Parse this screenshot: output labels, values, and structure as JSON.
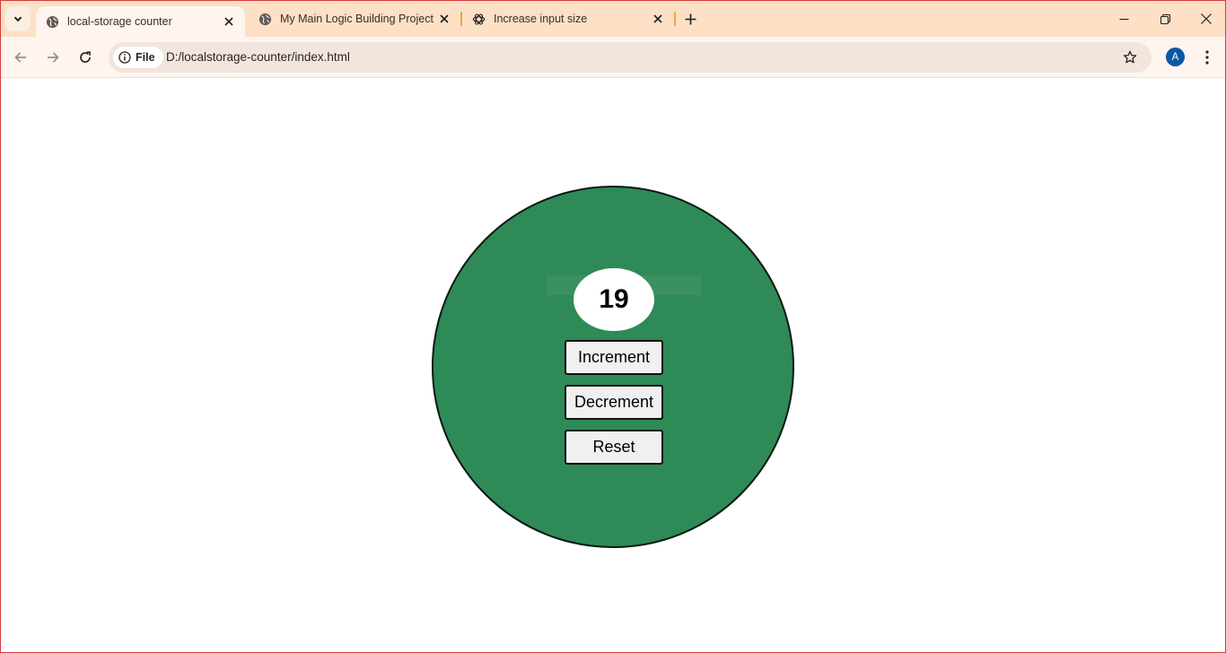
{
  "tabs": [
    {
      "title": "local-storage counter",
      "icon": "globe-icon",
      "active": true
    },
    {
      "title": "My Main Logic Building Project",
      "icon": "globe-icon",
      "active": false
    },
    {
      "title": "Increase input size",
      "icon": "openai-icon",
      "active": false
    }
  ],
  "toolbar": {
    "site_chip": "File",
    "url": "D:/localstorage-counter/index.html",
    "profile_initial": "A"
  },
  "counter": {
    "value": "19",
    "increment_label": "Increment",
    "decrement_label": "Decrement",
    "reset_label": "Reset"
  },
  "colors": {
    "circle": "#2e8a57",
    "tabstrip": "#fde0c5",
    "toolbar": "#fff4ee",
    "avatar": "#0b57a4"
  }
}
